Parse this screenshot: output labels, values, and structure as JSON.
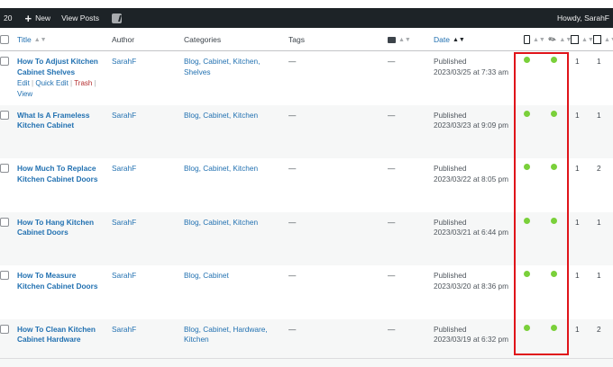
{
  "admin_bar": {
    "count": "20",
    "new_label": "New",
    "view_posts_label": "View Posts",
    "greeting": "Howdy, SarahF"
  },
  "table": {
    "headers": {
      "title": "Title",
      "author": "Author",
      "categories": "Categories",
      "tags": "Tags",
      "date": "Date"
    },
    "row_actions": {
      "edit": "Edit",
      "quick_edit": "Quick Edit",
      "trash": "Trash",
      "view": "View",
      "separator": "|"
    },
    "status_dot_color": "#7ad03a",
    "highlight_color": "#e0141a",
    "rows": [
      {
        "title_l1": "How To Adjust Kitchen",
        "title_l2": "Cabinet Shelves",
        "author": "SarahF",
        "cats_l1": "Blog, Cabinet, Kitchen,",
        "cats_l2": "Shelves",
        "tags": "—",
        "comments": "—",
        "status": "Published",
        "date": "2023/03/25 at 7:33 am",
        "links_in": "1",
        "links_out": "1"
      },
      {
        "title_l1": "What Is A Frameless",
        "title_l2": "Kitchen Cabinet",
        "author": "SarahF",
        "cats_l1": "Blog, Cabinet, Kitchen",
        "cats_l2": "",
        "tags": "—",
        "comments": "—",
        "status": "Published",
        "date": "2023/03/23 at 9:09 pm",
        "links_in": "1",
        "links_out": "1"
      },
      {
        "title_l1": "How Much To Replace",
        "title_l2": "Kitchen Cabinet Doors",
        "author": "SarahF",
        "cats_l1": "Blog, Cabinet, Kitchen",
        "cats_l2": "",
        "tags": "—",
        "comments": "—",
        "status": "Published",
        "date": "2023/03/22 at 8:05 pm",
        "links_in": "1",
        "links_out": "2"
      },
      {
        "title_l1": "How To Hang Kitchen",
        "title_l2": "Cabinet Doors",
        "author": "SarahF",
        "cats_l1": "Blog, Cabinet, Kitchen",
        "cats_l2": "",
        "tags": "—",
        "comments": "—",
        "status": "Published",
        "date": "2023/03/21 at 6:44 pm",
        "links_in": "1",
        "links_out": "1"
      },
      {
        "title_l1": "How To Measure",
        "title_l2": "Kitchen Cabinet Doors",
        "author": "SarahF",
        "cats_l1": "Blog, Cabinet",
        "cats_l2": "",
        "tags": "—",
        "comments": "—",
        "status": "Published",
        "date": "2023/03/20 at 8:36 pm",
        "links_in": "1",
        "links_out": "1"
      },
      {
        "title_l1": "How To Clean Kitchen",
        "title_l2": "Cabinet Hardware",
        "author": "SarahF",
        "cats_l1": "Blog, Cabinet, Hardware,",
        "cats_l2": "Kitchen",
        "tags": "—",
        "comments": "—",
        "status": "Published",
        "date": "2023/03/19 at 6:32 pm",
        "links_in": "1",
        "links_out": "2"
      }
    ]
  }
}
